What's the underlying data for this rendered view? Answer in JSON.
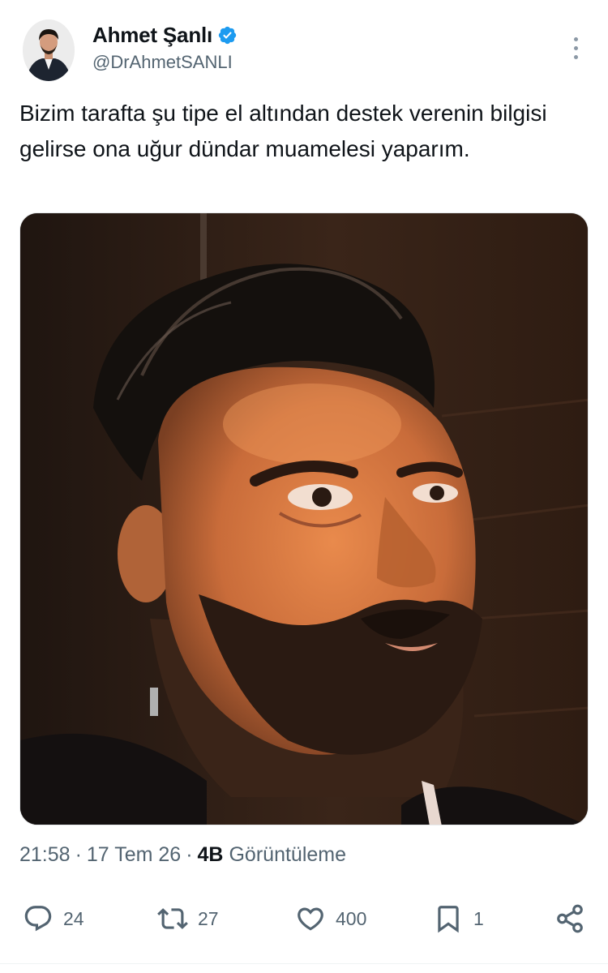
{
  "author": {
    "display_name": "Ahmet Şanlı",
    "handle": "@DrAhmetSANLI",
    "verified": true,
    "verified_color": "#1d9bf0"
  },
  "tweet": {
    "text": "Bizim tarafta şu tipe el altından destek verenin bilgisi gelirse ona uğur dündar muamelesi yaparım.",
    "time": "21:58",
    "date": "17 Tem 26",
    "separator": "·",
    "views_count": "4B",
    "views_label": "Görüntüleme"
  },
  "actions": {
    "replies": "24",
    "reposts": "27",
    "likes": "400",
    "bookmarks": "1"
  },
  "icons": {
    "more": "more-vertical-icon",
    "reply": "reply-icon",
    "repost": "repost-icon",
    "like": "heart-icon",
    "bookmark": "bookmark-icon",
    "share": "share-icon",
    "verified": "verified-badge-icon"
  },
  "colors": {
    "text_primary": "#0f1419",
    "text_secondary": "#536471",
    "accent": "#1d9bf0"
  }
}
